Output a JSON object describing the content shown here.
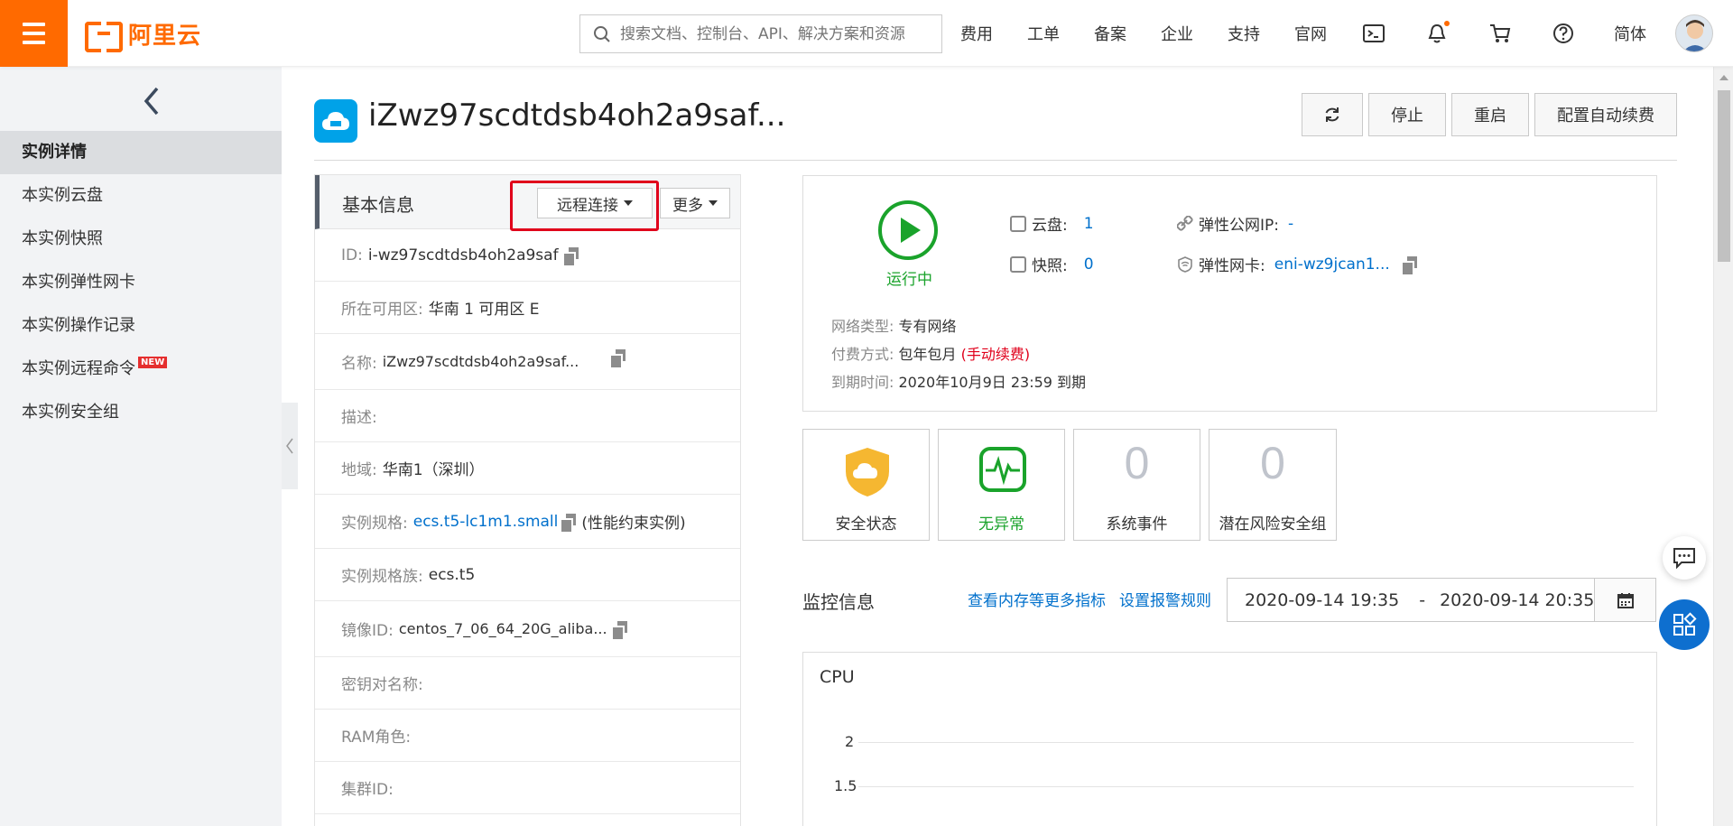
{
  "topbar": {
    "logo_text": "阿里云",
    "search_placeholder": "搜索文档、控制台、API、解决方案和资源",
    "nav": [
      "费用",
      "工单",
      "备案",
      "企业",
      "支持",
      "官网"
    ],
    "lang": "简体",
    "icons": [
      "terminal-icon",
      "bell-icon",
      "cart-icon",
      "help-icon"
    ],
    "accent": "#ff6a00"
  },
  "sidebar": {
    "items": [
      {
        "label": "实例详情",
        "active": true
      },
      {
        "label": "本实例云盘"
      },
      {
        "label": "本实例快照"
      },
      {
        "label": "本实例弹性网卡"
      },
      {
        "label": "本实例操作记录"
      },
      {
        "label": "本实例远程命令",
        "badge": "NEW"
      },
      {
        "label": "本实例安全组"
      }
    ]
  },
  "header": {
    "title": "iZwz97scdtdsb4oh2a9saf...",
    "buttons": [
      "停止",
      "重启",
      "配置自动续费"
    ]
  },
  "basic_info": {
    "title": "基本信息",
    "remote_btn": "远程连接",
    "more_btn": "更多",
    "rows": [
      {
        "label": "ID:",
        "value": "i-wz97scdtdsb4oh2a9saf"
      },
      {
        "label": "所在可用区:",
        "value": "华南 1 可用区 E"
      },
      {
        "label": "名称:",
        "value": "iZwz97scdtdsb4oh2a9saf..."
      },
      {
        "label": "描述:",
        "value": ""
      },
      {
        "label": "地域:",
        "value": "华南1（深圳）"
      },
      {
        "label": "实例规格:",
        "value": "ecs.t5-lc1m1.small",
        "suffix": "(性能约束实例)"
      },
      {
        "label": "实例规格族:",
        "value": "ecs.t5"
      },
      {
        "label": "镜像ID:",
        "value": "centos_7_06_64_20G_aliba..."
      },
      {
        "label": "密钥对名称:",
        "value": ""
      },
      {
        "label": "RAM角色:",
        "value": ""
      },
      {
        "label": "集群ID:",
        "value": ""
      }
    ]
  },
  "status": {
    "state": "运行中",
    "disk_label": "云盘:",
    "disk_count": "1",
    "snapshot_label": "快照:",
    "snapshot_count": "0",
    "eip_label": "弹性公网IP:",
    "eip_value": "-",
    "eni_label": "弹性网卡:",
    "eni_value": "eni-wz9jcan1...",
    "network_label": "网络类型:",
    "network_value": "专有网络",
    "billing_label": "付费方式:",
    "billing_value": "包年包月",
    "billing_note": "(手动续费)",
    "expire_label": "到期时间:",
    "expire_value": "2020年10月9日 23:59 到期"
  },
  "tiles": [
    {
      "label": "安全状态"
    },
    {
      "label": "无异常"
    },
    {
      "label": "系统事件",
      "value": "0"
    },
    {
      "label": "潜在风险安全组",
      "value": "0"
    }
  ],
  "monitor": {
    "title": "监控信息",
    "link1": "查看内存等更多指标",
    "link2": "设置报警规则",
    "date_from": "2020-09-14 19:35",
    "date_sep": "-",
    "date_to": "2020-09-14 20:35",
    "chart_title": "CPU",
    "y_ticks": [
      "2",
      "1.5"
    ]
  }
}
